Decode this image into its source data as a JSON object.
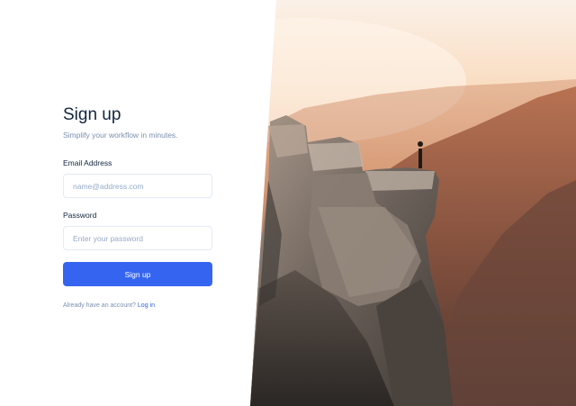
{
  "form": {
    "title": "Sign up",
    "subtitle": "Simplify your workflow in minutes.",
    "email": {
      "label": "Email Address",
      "placeholder": "name@address.com",
      "value": ""
    },
    "password": {
      "label": "Password",
      "placeholder": "Enter your password",
      "value": ""
    },
    "submit_label": "Sign up",
    "footer_prompt": "Already have an account?",
    "login_link": "Log in"
  },
  "hero": {
    "description": "mountain-cliff-photo"
  },
  "colors": {
    "accent": "#3565f0",
    "title": "#12263f",
    "muted": "#7b90b0",
    "border": "#e3ebf6"
  }
}
